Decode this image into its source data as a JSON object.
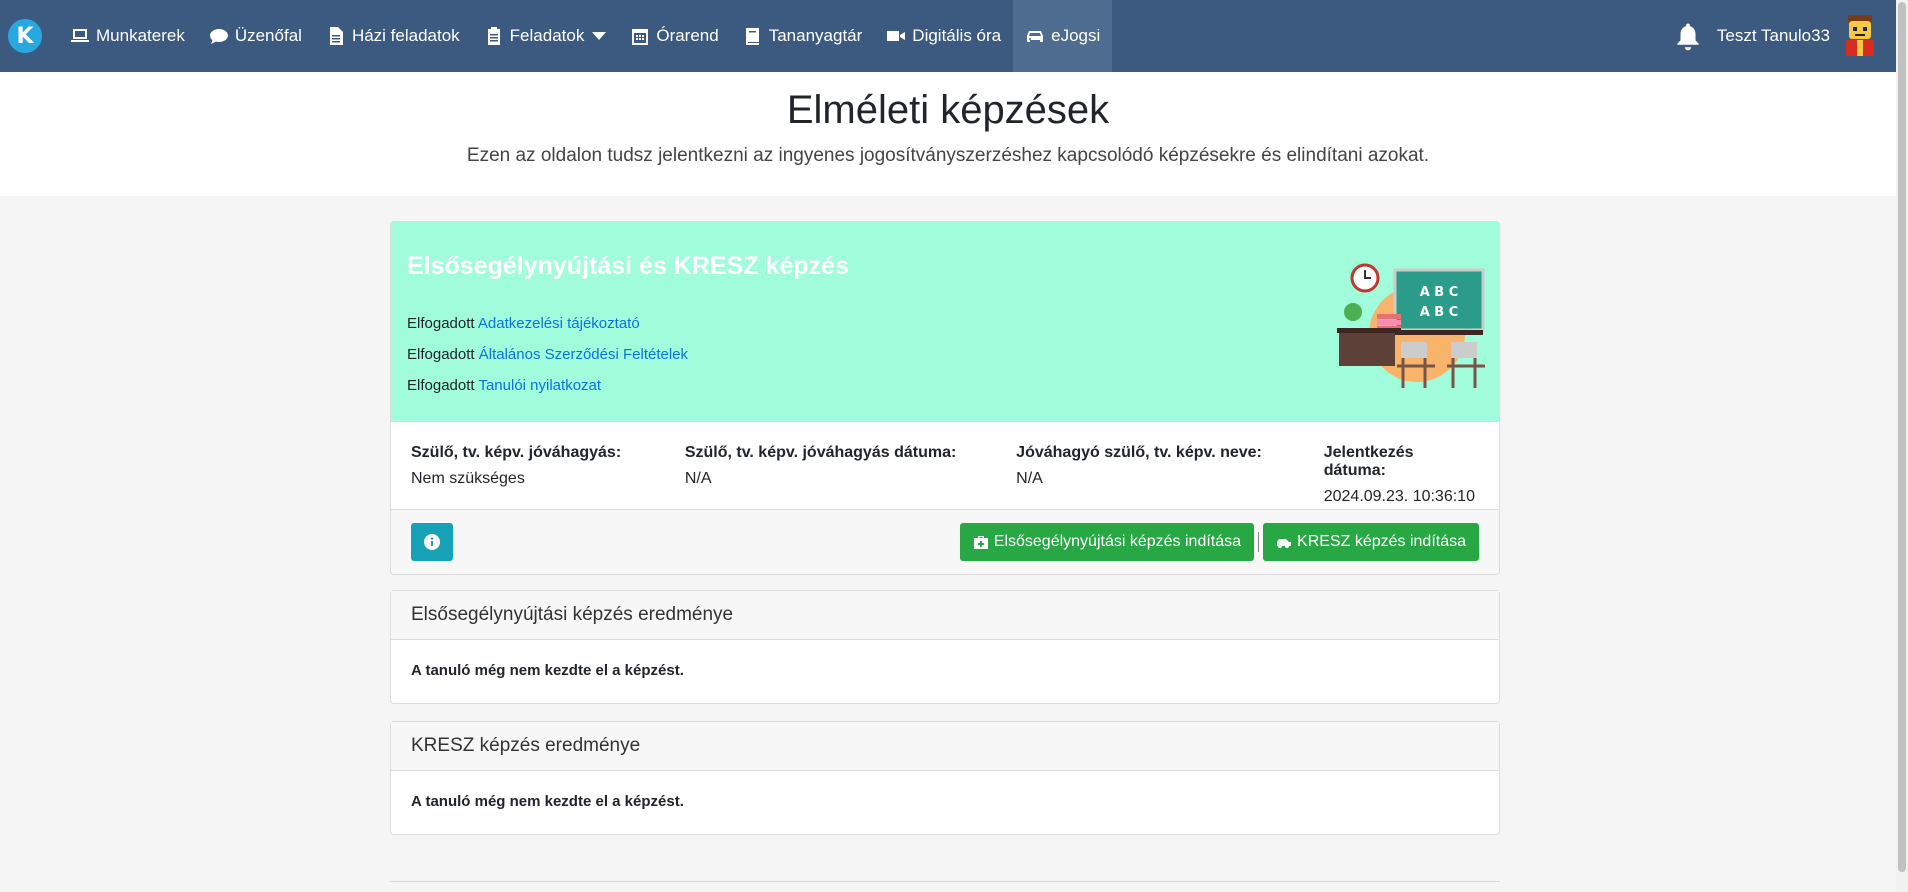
{
  "nav": {
    "logo_letter": "K",
    "items": [
      {
        "label": "Munkaterek",
        "icon": "laptop-icon"
      },
      {
        "label": "Üzenőfal",
        "icon": "comment-icon"
      },
      {
        "label": "Házi feladatok",
        "icon": "file-icon"
      },
      {
        "label": "Feladatok",
        "icon": "clipboard-icon"
      },
      {
        "label": "Órarend",
        "icon": "calendar-icon"
      },
      {
        "label": "Tananyagtár",
        "icon": "book-icon"
      },
      {
        "label": "Digitális óra",
        "icon": "video-icon"
      },
      {
        "label": "eJogsi",
        "icon": "car-icon"
      }
    ],
    "user_name": "Teszt Tanulo33"
  },
  "header": {
    "title": "Elméleti képzések",
    "subtitle": "Ezen az oldalon tudsz jelentkezni az ingyenes jogosítványszerzéshez kapcsolódó képzésekre és elindítani azokat."
  },
  "card": {
    "title": "Elsősegélynyújtási és KRESZ képzés",
    "accepted_prefix": "Elfogadott",
    "accepted_links": [
      "Adatkezelési tájékoztató",
      "Általános Szerződési Feltételek",
      "Tanulói nyilatkozat"
    ],
    "illustration_text": "A B C",
    "info": [
      {
        "label": "Szülő, tv. képv. jóváhagyás:",
        "value": "Nem szükséges"
      },
      {
        "label": "Szülő, tv. képv. jóváhagyás dátuma:",
        "value": "N/A"
      },
      {
        "label": "Jóváhagyó szülő, tv. képv. neve:",
        "value": "N/A"
      },
      {
        "label": "Jelentkezés dátuma:",
        "value": "2024.09.23. 10:36:10"
      }
    ],
    "btn_first_aid": "Elsősegélynyújtási képzés indítása",
    "btn_kresz": "KRESZ képzés indítása"
  },
  "results": [
    {
      "title": "Elsősegélynyújtási képzés eredménye",
      "body": "A tanuló még nem kezdte el a képzést."
    },
    {
      "title": "KRESZ képzés eredménye",
      "body": "A tanuló még nem kezdte el a képzést."
    }
  ],
  "colors": {
    "navbar": "#3c5a80",
    "card_top": "#a0fcdb",
    "success": "#28a745",
    "info": "#17a2b8",
    "link": "#0a74d8"
  }
}
